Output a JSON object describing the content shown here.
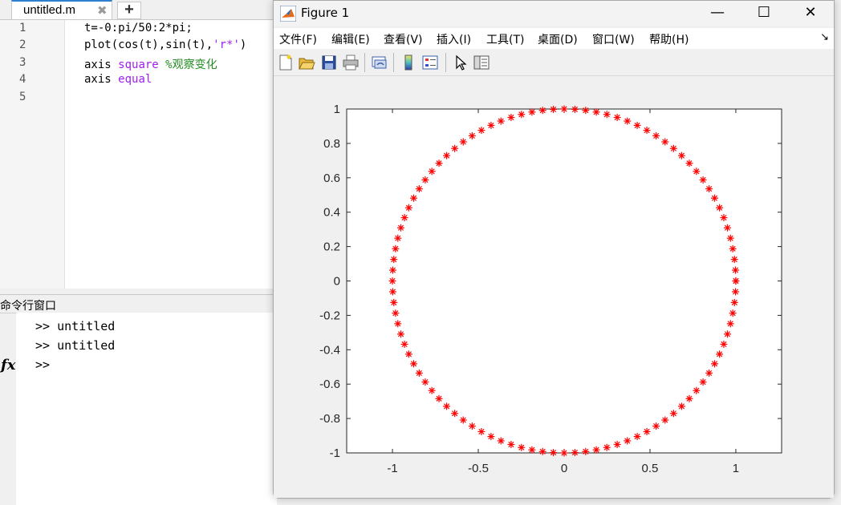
{
  "editor": {
    "tab": {
      "label": "untitled.m",
      "close": "✖"
    },
    "add_tab": "+",
    "line_numbers": [
      "1",
      "2",
      "3",
      "4",
      "5"
    ],
    "code": [
      {
        "pre": "t=-0:pi/50:2*pi;",
        "kw": "",
        "str": "",
        "post": "",
        "cmt": ""
      },
      {
        "pre": "plot(cos(t),sin(t),",
        "kw": "",
        "str": "'r*'",
        "post": ")",
        "cmt": ""
      },
      {
        "pre": "axis ",
        "kw": "square",
        "str": "",
        "post": " ",
        "cmt": "%观察变化"
      },
      {
        "pre": "axis ",
        "kw": "equal",
        "str": "",
        "post": "",
        "cmt": ""
      },
      {
        "pre": "",
        "kw": "",
        "str": "",
        "post": "",
        "cmt": ""
      }
    ]
  },
  "command_window": {
    "title": "命令行窗口",
    "fx": "fx",
    "lines": [
      ">> untitled",
      ">> untitled",
      ">>"
    ]
  },
  "figure": {
    "title": "Figure 1",
    "window_buttons": {
      "minimize": "—",
      "maximize": "☐",
      "close": "✕"
    },
    "menu": [
      "文件(F)",
      "编辑(E)",
      "查看(V)",
      "插入(I)",
      "工具(T)",
      "桌面(D)",
      "窗口(W)",
      "帮助(H)"
    ],
    "menu_overflow": "↘",
    "toolbar_icons": [
      "new-figure-icon",
      "open-file-icon",
      "save-icon",
      "print-icon",
      "link-plot-icon",
      "colorbar-icon",
      "legend-icon",
      "pointer-icon",
      "property-editor-icon"
    ]
  },
  "chart_data": {
    "type": "scatter",
    "marker": "*",
    "color": "#ff0000",
    "title": "",
    "xlabel": "",
    "ylabel": "",
    "xlim": [
      -1.2667,
      1.2667
    ],
    "ylim": [
      -1,
      1
    ],
    "xticks": [
      -1,
      -0.5,
      0,
      0.5,
      1
    ],
    "xtick_labels": [
      "-1",
      "-0.5",
      "0",
      "0.5",
      "1"
    ],
    "yticks": [
      -1,
      -0.8,
      -0.6,
      -0.4,
      -0.2,
      0,
      0.2,
      0.4,
      0.6,
      0.8,
      1
    ],
    "ytick_labels": [
      "-1",
      "-0.8",
      "-0.6",
      "-0.4",
      "-0.2",
      "0",
      "0.2",
      "0.4",
      "0.6",
      "0.8",
      "1"
    ],
    "series": [
      {
        "t_start": 0,
        "t_step": 0.0628318531,
        "t_end": 6.2831853072,
        "x": "cos(t)",
        "y": "sin(t)"
      }
    ],
    "grid": false
  }
}
